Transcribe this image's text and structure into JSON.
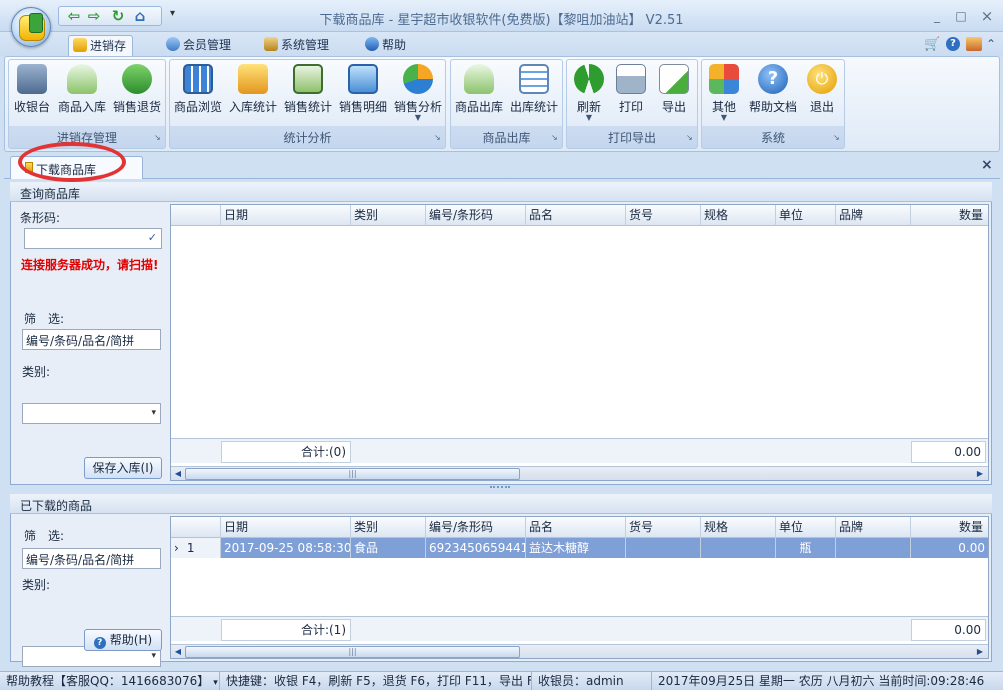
{
  "window": {
    "title": "下载商品库 - 星宇超市收银软件(免费版)【黎咀加油站】 V2.51",
    "minimize": "_",
    "maximize": "□",
    "close": "×"
  },
  "quick_access": [
    "back-icon",
    "forward-icon",
    "refresh-icon",
    "home-icon"
  ],
  "menu_tabs": [
    {
      "label": "进销存",
      "active": true
    },
    {
      "label": "会员管理"
    },
    {
      "label": "系统管理"
    },
    {
      "label": "帮助"
    }
  ],
  "ribbon_groups": [
    {
      "caption": "进销存管理",
      "buttons": [
        {
          "label": "收银台",
          "icon": "cashier-icon"
        },
        {
          "label": "商品入库",
          "icon": "db-in-icon"
        },
        {
          "label": "销售退货",
          "icon": "return-icon"
        }
      ]
    },
    {
      "caption": "统计分析",
      "buttons": [
        {
          "label": "商品浏览",
          "icon": "grid-icon"
        },
        {
          "label": "入库统计",
          "icon": "books-icon"
        },
        {
          "label": "销售统计",
          "icon": "card-icon"
        },
        {
          "label": "销售明细",
          "icon": "detail-icon"
        },
        {
          "label": "销售分析",
          "icon": "pie-icon",
          "dropdown": true
        }
      ]
    },
    {
      "caption": "商品出库",
      "buttons": [
        {
          "label": "商品出库",
          "icon": "db-out-icon"
        },
        {
          "label": "出库统计",
          "icon": "list-icon"
        }
      ]
    },
    {
      "caption": "打印导出",
      "buttons": [
        {
          "label": "刷新",
          "icon": "refresh-icon",
          "dropdown": true
        },
        {
          "label": "打印",
          "icon": "printer-icon"
        },
        {
          "label": "导出",
          "icon": "export-icon"
        }
      ]
    },
    {
      "caption": "系统",
      "buttons": [
        {
          "label": "其他",
          "icon": "apps-icon",
          "dropdown": true
        },
        {
          "label": "帮助文档",
          "icon": "help-icon"
        },
        {
          "label": "退出",
          "icon": "power-icon"
        }
      ]
    }
  ],
  "doc_tab": {
    "label": "下载商品库"
  },
  "query_panel": {
    "title": "查询商品库",
    "barcode_label": "条形码:",
    "barcode_value": "",
    "status_message": "连接服务器成功，请扫描!",
    "filter_label": "筛　选:",
    "filter_value": "编号/条码/品名/简拼",
    "category_label": "类别:",
    "category_value": "",
    "save_button": "保存入库(I)",
    "total_label": "合计:(0)",
    "total_value": "0.00"
  },
  "columns": [
    "日期",
    "类别",
    "编号/条形码",
    "品名",
    "货号",
    "规格",
    "单位",
    "品牌",
    "数量"
  ],
  "downloaded_panel": {
    "title": "已下载的商品",
    "filter_label": "筛　选:",
    "filter_value": "编号/条码/品名/简拼",
    "category_label": "类别:",
    "category_value": "",
    "help_button": "帮助(H)",
    "rows": [
      {
        "row_num": "1",
        "date": "2017-09-25 08:58:30",
        "category": "食品",
        "code": "6923450659441",
        "name": "益达木糖醇",
        "item_no": "",
        "spec": "",
        "unit": "瓶",
        "brand": "",
        "qty": "0.00"
      }
    ],
    "total_label": "合计:(1)",
    "total_value": "0.00"
  },
  "statusbar": {
    "help": "帮助教程【客服QQ：1416683076】",
    "shortcuts": "快捷键：收银 F4，刷新 F5，退货 F6，打印 F11，导出 F12",
    "cashier": "收银员：admin",
    "datetime": "2017年09月25日 星期一 农历 八月初六 当前时间:09:28:46"
  }
}
